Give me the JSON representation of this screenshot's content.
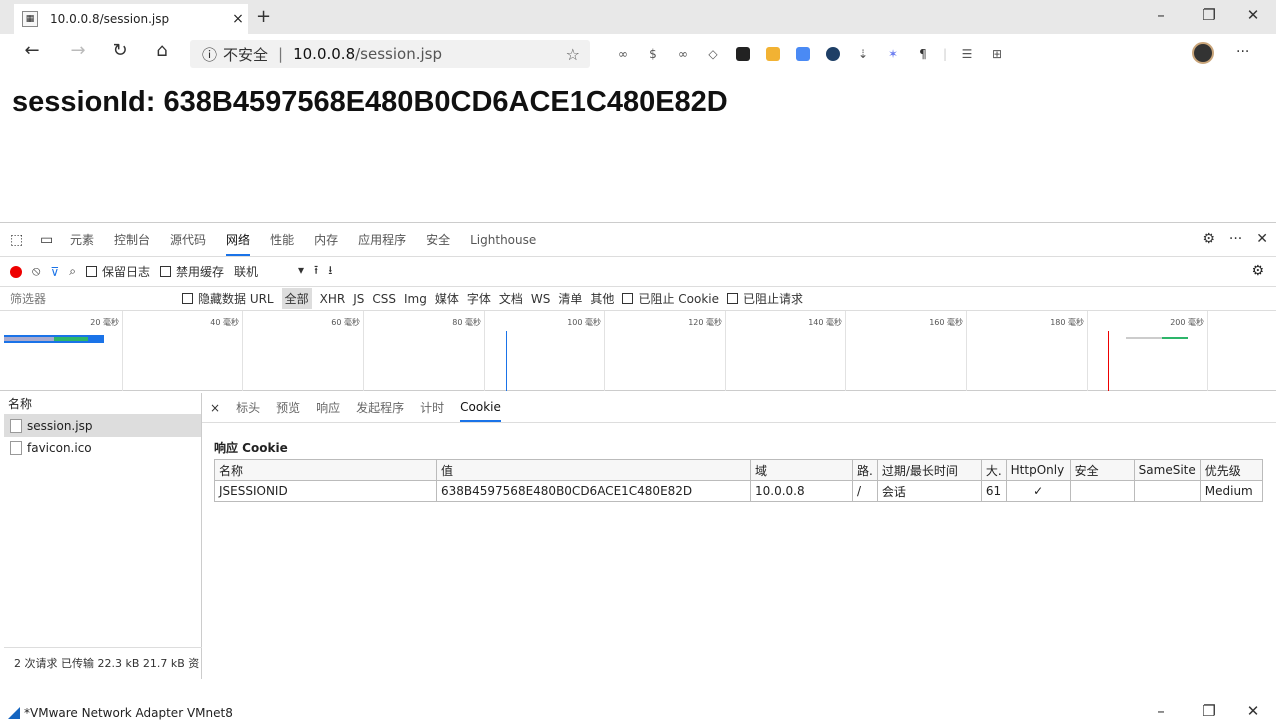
{
  "browser": {
    "tab_title": "10.0.0.8/session.jsp",
    "tab_close": "×",
    "new_tab": "+",
    "window_controls": {
      "minimize": "–",
      "restore": "❐",
      "close": "✕"
    },
    "nav": {
      "back": "←",
      "forward": "→",
      "refresh": "↻",
      "home": "⌂"
    },
    "url": {
      "security_icon": "ⓘ",
      "security_text": "不安全",
      "separator": "|",
      "host": "10.0.0.8",
      "path": "/session.jsp",
      "favorite": "☆"
    },
    "menu_more": "···"
  },
  "page": {
    "session_text": "sessionId: 638B4597568E480B0CD6ACE1C480E82D"
  },
  "devtools": {
    "tabs": [
      "元素",
      "控制台",
      "源代码",
      "网络",
      "性能",
      "内存",
      "应用程序",
      "安全",
      "Lighthouse"
    ],
    "active_tab": "网络",
    "toolbar": {
      "preserve_log": "保留日志",
      "disable_cache": "禁用缓存",
      "throttle": "联机",
      "throttle_caret": "▾"
    },
    "filter": {
      "placeholder": "筛选器",
      "hide_data_url": "隐藏数据 URL",
      "types": [
        "全部",
        "XHR",
        "JS",
        "CSS",
        "Img",
        "媒体",
        "字体",
        "文档",
        "WS",
        "清单",
        "其他"
      ],
      "selected_type": "全部",
      "blocked_cookies": "已阻止 Cookie",
      "blocked_requests": "已阻止请求"
    },
    "timeline_ticks": [
      "20 毫秒",
      "40 毫秒",
      "60 毫秒",
      "80 毫秒",
      "100 毫秒",
      "120 毫秒",
      "140 毫秒",
      "160 毫秒",
      "180 毫秒",
      "200 毫秒"
    ],
    "requests": {
      "header": "名称",
      "items": [
        "session.jsp",
        "favicon.ico"
      ],
      "selected": "session.jsp",
      "status": "2 次请求  已传输 22.3 kB  21.7 kB 资"
    },
    "detail": {
      "close": "×",
      "tabs": [
        "标头",
        "预览",
        "响应",
        "发起程序",
        "计时",
        "Cookie"
      ],
      "active_tab": "Cookie",
      "section_title": "响应 Cookie",
      "columns": [
        "名称",
        "值",
        "域",
        "路.",
        "过期/最长时间",
        "大.",
        "HttpOnly",
        "安全",
        "SameSite",
        "优先级"
      ],
      "rows": [
        [
          "JSESSIONID",
          "638B4597568E480B0CD6ACE1C480E82D",
          "10.0.0.8",
          "/",
          "会话",
          "61",
          "✓",
          "",
          "",
          "Medium"
        ]
      ]
    }
  },
  "bottom_window": {
    "title": "*VMware Network Adapter VMnet8"
  },
  "colors": {
    "accent": "#1a73e8",
    "record": "#e00000"
  }
}
